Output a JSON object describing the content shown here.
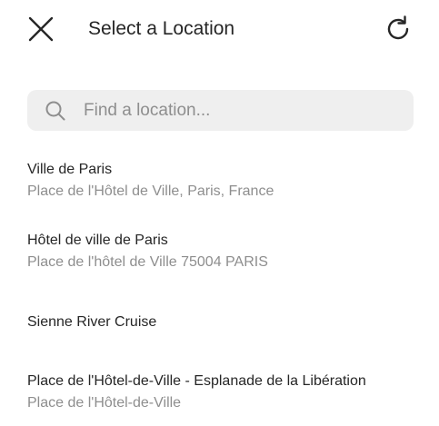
{
  "header": {
    "title": "Select a Location",
    "close_icon": "close-icon",
    "refresh_icon": "refresh-icon"
  },
  "search": {
    "placeholder": "Find a location...",
    "value": "",
    "icon": "search-icon"
  },
  "results": [
    {
      "name": "Ville de Paris",
      "address": "Place de l'Hôtel de Ville, Paris, France"
    },
    {
      "name": "Hôtel de ville de Paris",
      "address": "Place de l'hôtel de Ville 75004 PARIS"
    },
    {
      "name": "Sienne River Cruise",
      "address": ""
    },
    {
      "name": "Place de l'Hôtel-de-Ville - Esplanade de la Libération",
      "address": "Place de l'Hôtel-de-Ville"
    }
  ],
  "colors": {
    "primary_text": "#262626",
    "secondary_text": "#8e8e8e",
    "search_background": "#efefef"
  }
}
